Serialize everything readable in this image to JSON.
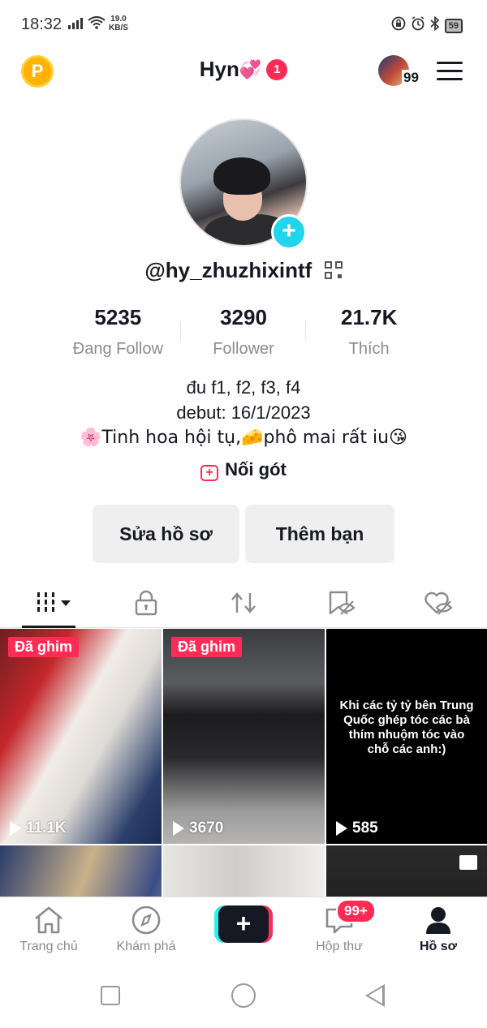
{
  "status_bar": {
    "time": "18:32",
    "net_speed_value": "19.0",
    "net_speed_unit": "KB/S",
    "battery": "59"
  },
  "header": {
    "coin_letter": "P",
    "title": "Hyn",
    "title_emoji": "💞",
    "notification_count": "1",
    "friends_count": "99"
  },
  "profile": {
    "username": "@hy_zhuzhixintf",
    "stats": [
      {
        "value": "5235",
        "label": "Đang Follow"
      },
      {
        "value": "3290",
        "label": "Follower"
      },
      {
        "value": "21.7K",
        "label": "Thích"
      }
    ],
    "bio_line1": "đu f1, f2, f3, f4",
    "bio_line2": "debut: 16/1/2023",
    "bio_line3": "🌸Tinh hoa hội tụ,🧀phô mai rất iu😘",
    "link_label": "Nối gót",
    "edit_button": "Sửa hồ sơ",
    "add_friend_button": "Thêm bạn"
  },
  "tabs": [
    "videos-grid",
    "private",
    "reposts",
    "saved",
    "liked"
  ],
  "videos": [
    {
      "pinned_label": "Đã ghim",
      "views": "11.1K"
    },
    {
      "pinned_label": "Đã ghim",
      "views": "3670"
    },
    {
      "caption": "Khi các tỷ tỷ bên Trung Quốc ghép tóc các bà thím nhuộm tóc vào chỗ các anh:)",
      "views": "585"
    }
  ],
  "bottom_nav": {
    "home": "Trang chủ",
    "explore": "Khám phá",
    "create": "+",
    "inbox": "Hộp thư",
    "inbox_badge": "99+",
    "profile": "Hồ sơ"
  },
  "colors": {
    "accent": "#fe2c55",
    "cyan": "#25f4ee",
    "text": "#161823",
    "muted": "#8a8b91"
  }
}
